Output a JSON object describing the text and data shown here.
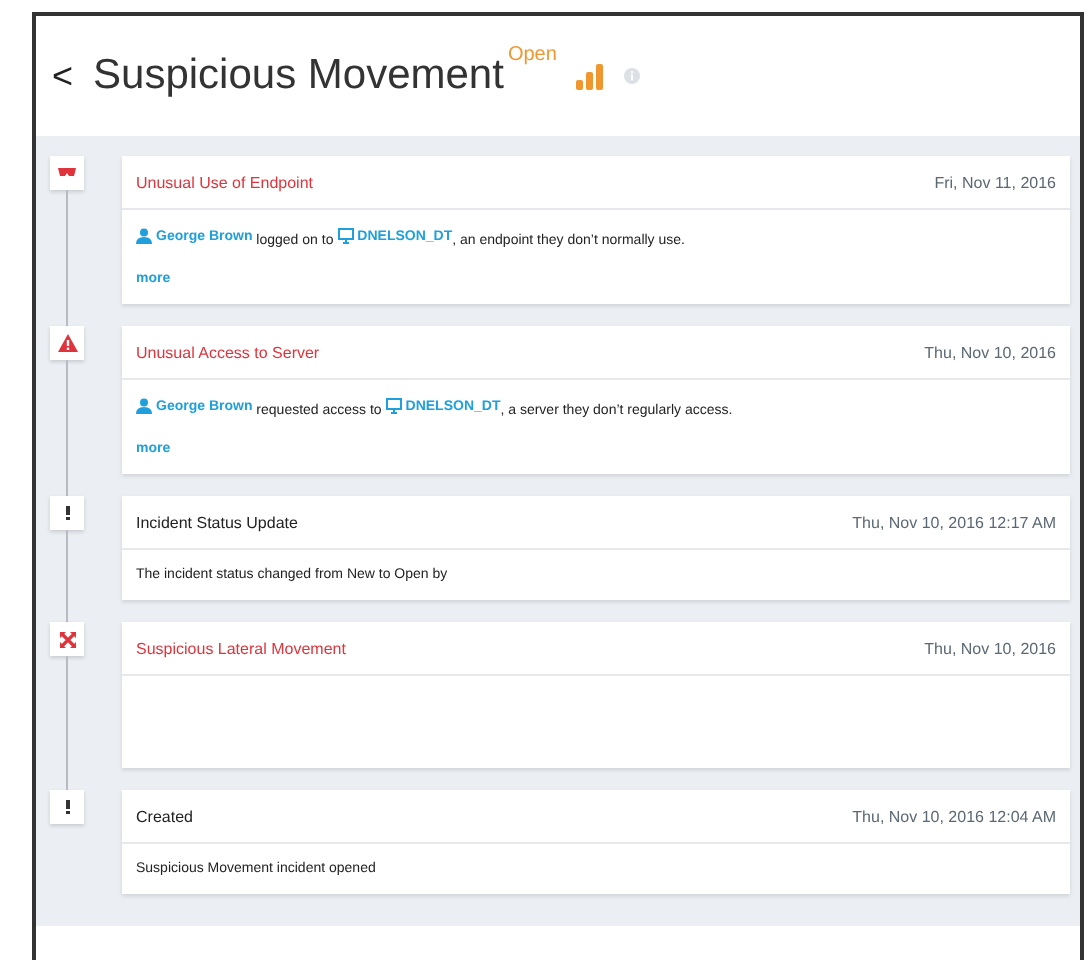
{
  "header": {
    "back": "<",
    "title": "Suspicious Movement",
    "status": "Open"
  },
  "events": [
    {
      "kind": "endpoint",
      "alert": true,
      "title": "Unusual Use of Endpoint",
      "date": "Fri, Nov 11, 2016",
      "body": [
        {
          "kind": "user",
          "text": "George Brown"
        },
        {
          "kind": "text",
          "text": " logged on to "
        },
        {
          "kind": "device",
          "text": "DNELSON_DT"
        },
        {
          "kind": "text",
          "text": ", an endpoint they don’t normally use."
        }
      ],
      "more": "more"
    },
    {
      "kind": "warning",
      "alert": true,
      "title": "Unusual Access to Server",
      "date": "Thu, Nov 10, 2016",
      "body": [
        {
          "kind": "user",
          "text": "George Brown"
        },
        {
          "kind": "text",
          "text": " requested access to "
        },
        {
          "kind": "device",
          "text": "DNELSON_DT"
        },
        {
          "kind": "text",
          "text": ", a server they don’t regularly access."
        }
      ],
      "more": "more"
    },
    {
      "kind": "info",
      "alert": false,
      "title": "Incident Status Update",
      "date": "Thu, Nov 10, 2016 12:17 AM",
      "body": [
        {
          "kind": "text",
          "text": "The incident status changed from New to Open by"
        }
      ]
    },
    {
      "kind": "lateral",
      "alert": true,
      "title": "Suspicious Lateral Movement",
      "date": "Thu, Nov 10, 2016"
    },
    {
      "kind": "info",
      "alert": false,
      "title": "Created",
      "date": "Thu, Nov 10, 2016 12:04 AM",
      "body": [
        {
          "kind": "text",
          "text": "Suspicious Movement incident opened"
        }
      ]
    }
  ]
}
